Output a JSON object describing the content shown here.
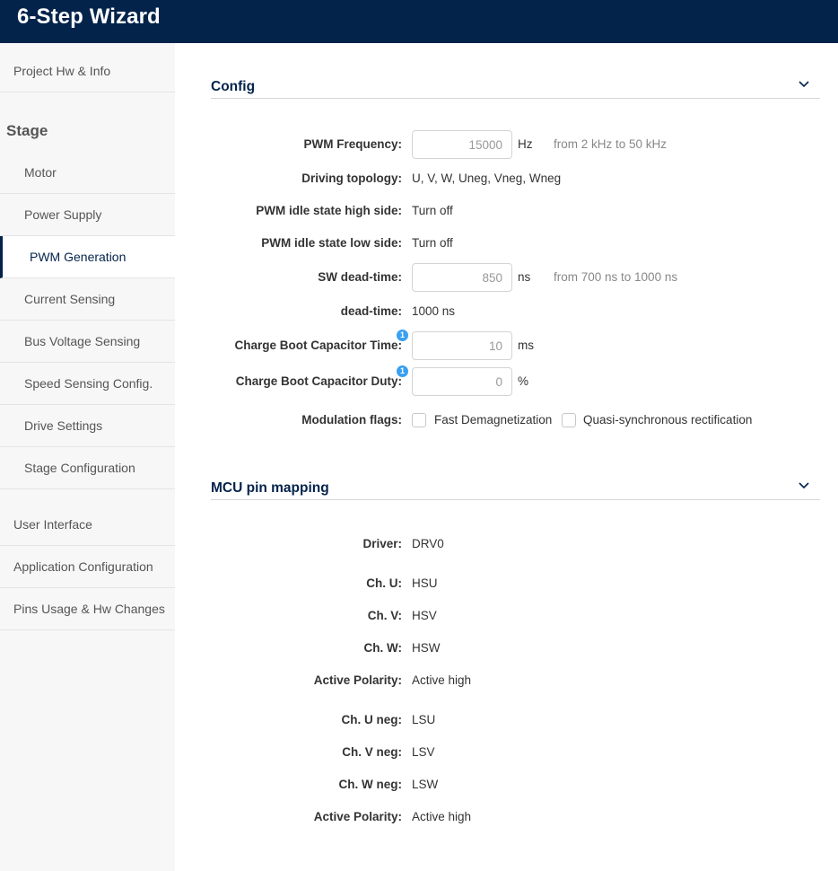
{
  "app": {
    "title": "6-Step Wizard"
  },
  "sidebar": {
    "items": [
      {
        "label": "Project Hw & Info"
      },
      {
        "label": "Motor"
      },
      {
        "label": "Power Supply"
      },
      {
        "label": "PWM Generation"
      },
      {
        "label": "Current Sensing"
      },
      {
        "label": "Bus Voltage Sensing"
      },
      {
        "label": "Speed Sensing Config."
      },
      {
        "label": "Drive Settings"
      },
      {
        "label": "Stage Configuration"
      },
      {
        "label": "User Interface"
      },
      {
        "label": "Application Configuration"
      },
      {
        "label": "Pins Usage & Hw Changes"
      }
    ],
    "stage_header": "Stage",
    "active_item": "PWM Generation"
  },
  "config": {
    "title": "Config",
    "pwm_frequency": {
      "label": "PWM Frequency:",
      "value": "15000",
      "unit": "Hz",
      "hint": "from 2 kHz to 50 kHz"
    },
    "driving_topology": {
      "label": "Driving topology:",
      "value": "U, V, W, Uneg, Vneg, Wneg"
    },
    "idle_high": {
      "label": "PWM idle state high side:",
      "value": "Turn off"
    },
    "idle_low": {
      "label": "PWM idle state low side:",
      "value": "Turn off"
    },
    "sw_deadtime": {
      "label": "SW dead-time:",
      "value": "850",
      "unit": "ns",
      "hint": "from 700 ns to 1000 ns"
    },
    "deadtime": {
      "label": "dead-time:",
      "value": "1000 ns"
    },
    "boot_time": {
      "label": "Charge Boot Capacitor Time:",
      "value": "10",
      "unit": "ms",
      "badge": "1"
    },
    "boot_duty": {
      "label": "Charge Boot Capacitor Duty:",
      "value": "0",
      "unit": "%",
      "badge": "1"
    },
    "modulation": {
      "label": "Modulation flags:",
      "opt1": "Fast Demagnetization",
      "opt2": "Quasi-synchronous rectification"
    }
  },
  "mcu": {
    "title": "MCU pin mapping",
    "rows": [
      {
        "label": "Driver:",
        "value": "DRV0"
      },
      {
        "label": "Ch. U:",
        "value": "HSU"
      },
      {
        "label": "Ch. V:",
        "value": "HSV"
      },
      {
        "label": "Ch. W:",
        "value": "HSW"
      },
      {
        "label": "Active Polarity:",
        "value": "Active high"
      },
      {
        "label": "Ch. U neg:",
        "value": "LSU"
      },
      {
        "label": "Ch. V neg:",
        "value": "LSV"
      },
      {
        "label": "Ch. W neg:",
        "value": "LSW"
      },
      {
        "label": "Active Polarity:",
        "value": "Active high"
      }
    ]
  },
  "colors": {
    "header_bg": "#03234b",
    "accent": "#03234b",
    "badge": "#3aa0f0",
    "sidebar_bg": "#f7f7f7"
  },
  "icons": {
    "collapse": "chevron-down-icon",
    "info_badge": "info-badge-icon"
  }
}
